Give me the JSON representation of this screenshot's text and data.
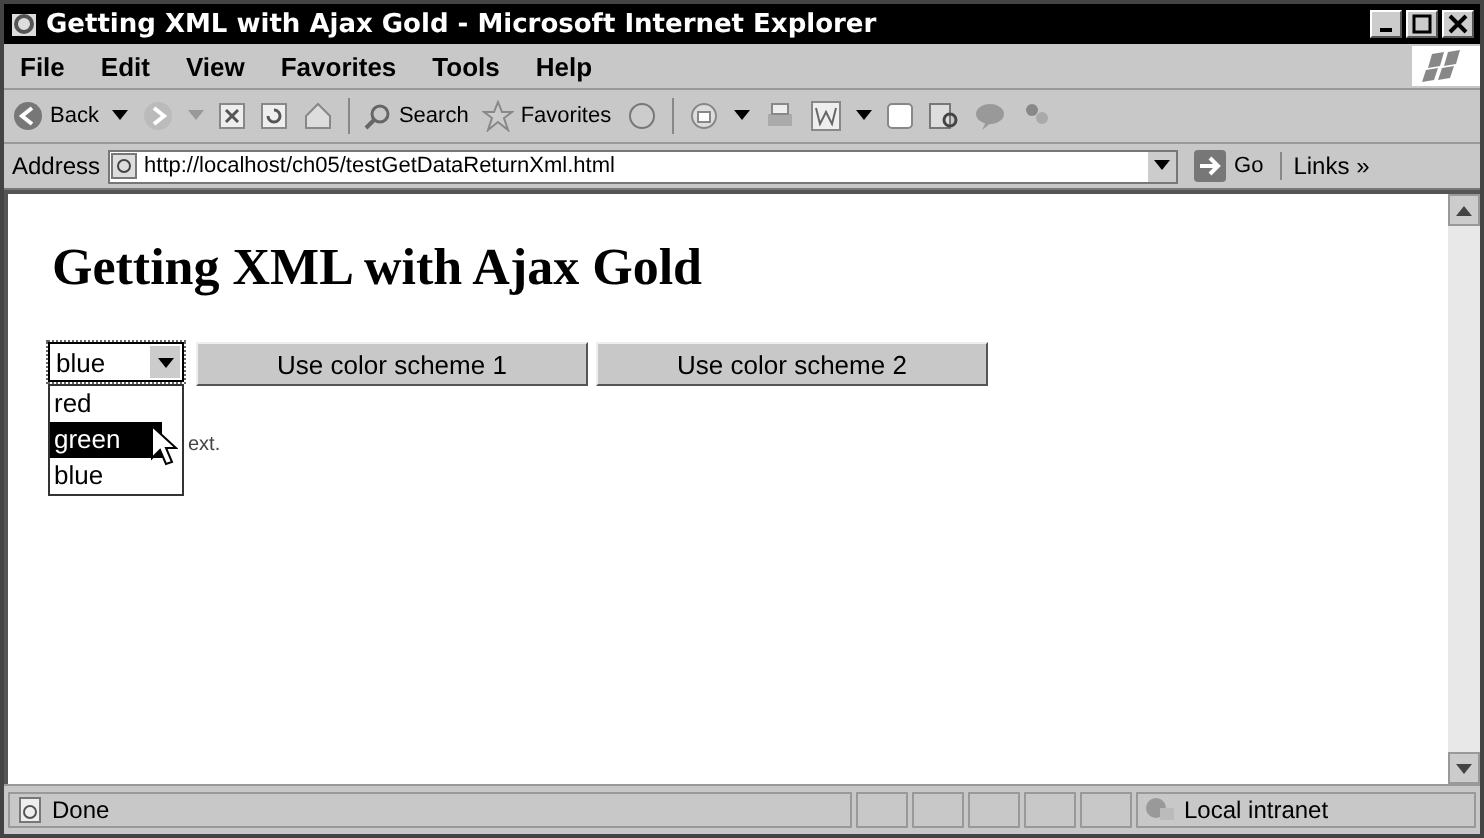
{
  "window": {
    "title": "Getting XML with Ajax Gold - Microsoft Internet Explorer"
  },
  "menu": [
    "File",
    "Edit",
    "View",
    "Favorites",
    "Tools",
    "Help"
  ],
  "toolbar": {
    "back": "Back",
    "search": "Search",
    "favorites": "Favorites"
  },
  "address_bar": {
    "label": "Address",
    "url": "http://localhost/ch05/testGetDataReturnXml.html",
    "go": "Go",
    "links": "Links »"
  },
  "page": {
    "heading": "Getting XML with Ajax Gold",
    "select": {
      "value": "blue",
      "expanded": true,
      "options": [
        {
          "label": "red",
          "highlighted": false
        },
        {
          "label": "green",
          "highlighted": true
        },
        {
          "label": "blue",
          "highlighted": false
        }
      ]
    },
    "buttons": [
      "Use color scheme 1",
      "Use color scheme 2"
    ],
    "partial_text": "ext."
  },
  "status_bar": {
    "status": "Done",
    "zone": "Local intranet"
  }
}
